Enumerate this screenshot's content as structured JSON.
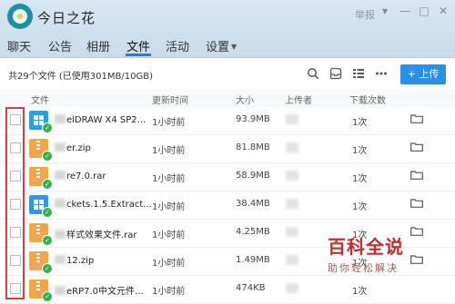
{
  "titlebar": {
    "group_name": "今日之花",
    "report_label": "举报",
    "window_buttons": [
      "▾",
      "—",
      "□",
      "✕"
    ]
  },
  "nav": {
    "tabs": [
      {
        "label": "聊天"
      },
      {
        "label": "公告"
      },
      {
        "label": "相册"
      },
      {
        "label": "文件",
        "active": true
      },
      {
        "label": "活动"
      },
      {
        "label": "设置",
        "has_dropdown": true
      }
    ],
    "active_color": "#2a7bd6"
  },
  "toolbar": {
    "file_count": "共29个文件 (已使用301MB/10GB)",
    "icons": [
      "search-icon",
      "inbox-icon",
      "list-view-icon",
      "more-icon"
    ],
    "upload_label": "+ 上传",
    "upload_color": "#2b8ee8"
  },
  "table": {
    "headers": {
      "file": "文件",
      "time": "更新时间",
      "size": "大小",
      "uploader": "上传者",
      "downloads": "下载次数"
    },
    "rows": [
      {
        "icon": "windows-exe-icon",
        "name": "elDRAW X4 SP2...",
        "time": "1小时前",
        "size": "93.9MB",
        "downloads": "1次"
      },
      {
        "icon": "zip-file-icon",
        "name": "er.zip",
        "time": "1小时前",
        "size": "81.8MB",
        "downloads": "1次"
      },
      {
        "icon": "zip-file-icon",
        "name": "re7.0.rar",
        "time": "1小时前",
        "size": "58.9MB",
        "downloads": "1次"
      },
      {
        "icon": "windows-exe-icon",
        "name": "ckets.1.5.Extract...",
        "time": "1小时前",
        "size": "38.4MB",
        "downloads": "1次"
      },
      {
        "icon": "zip-file-icon",
        "name": "样式效果文件.rar",
        "time": "1小时前",
        "size": "4.25MB",
        "downloads": "1次"
      },
      {
        "icon": "zip-file-icon",
        "name": "12.zip",
        "time": "1小时前",
        "size": "1.49MB",
        "downloads": "1次"
      },
      {
        "icon": "zip-file-icon",
        "name": "eRP7.0中文元件...",
        "time": "1小时前",
        "size": "474KB",
        "downloads": "1次"
      }
    ]
  },
  "watermark": {
    "title": "百科全说",
    "subtitle": "助你轻松解决"
  }
}
